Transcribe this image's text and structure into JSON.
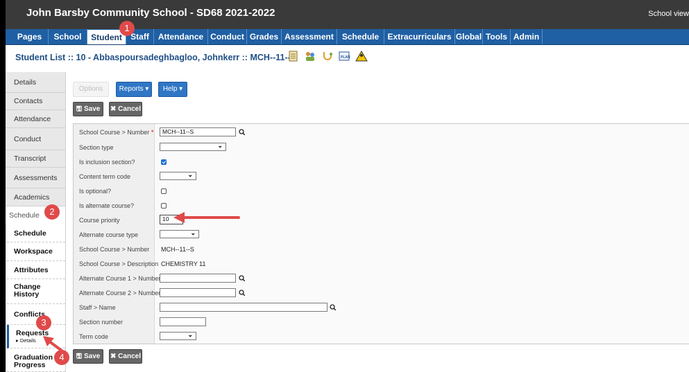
{
  "header": {
    "title": "John Barsby Community School - SD68 2021-2022",
    "view_label": "School view"
  },
  "nav": {
    "tabs": [
      "Pages",
      "School",
      "Student",
      "Staff",
      "Attendance",
      "Conduct",
      "Grades",
      "Assessment",
      "Schedule",
      "Extracurriculars",
      "Global",
      "Tools",
      "Admin"
    ],
    "active": "Student"
  },
  "breadcrumb": "Student List :: 10 - Abbaspoursadeghbagloo, Johnkerr :: MCH--11--S",
  "sidebar": {
    "items": [
      "Details",
      "Contacts",
      "Attendance",
      "Conduct",
      "Transcript",
      "Assessments",
      "Academics"
    ],
    "schedule_header": "Schedule",
    "schedule_items": [
      "Schedule",
      "Workspace",
      "Attributes",
      "Change History",
      "Conflicts",
      "Requests",
      "Graduation Progress"
    ],
    "requests_sub": "▸ Details"
  },
  "toolbar": {
    "options": "Options",
    "reports": "Reports ▾",
    "help": "Help ▾",
    "save": "Save",
    "cancel": "✖ Cancel"
  },
  "form": {
    "school_course_number_label": "School Course > Number",
    "school_course_number_value": "MCH--11--S",
    "section_type_label": "Section type",
    "inclusion_label": "Is inclusion section?",
    "inclusion_checked": true,
    "content_term_label": "Content term code",
    "optional_label": "Is optional?",
    "optional_checked": false,
    "alternate_course_label": "Is alternate course?",
    "alternate_checked": false,
    "priority_label": "Course priority",
    "priority_value": "10",
    "alt_type_label": "Alternate course type",
    "sc_number_label": "School Course > Number",
    "sc_number_value": "MCH--11--S",
    "sc_desc_label": "School Course > Description",
    "sc_desc_value": "CHEMISTRY 11",
    "alt1_label": "Alternate Course 1 > Number",
    "alt2_label": "Alternate Course 2 > Number",
    "staff_label": "Staff > Name",
    "section_number_label": "Section number",
    "term_code_label": "Term code"
  },
  "annotations": [
    "1",
    "2",
    "3",
    "4"
  ],
  "colors": {
    "nav_bg": "#1f5fa3",
    "title_bg": "#3a3a3a",
    "annotation": "#e04a4a"
  }
}
